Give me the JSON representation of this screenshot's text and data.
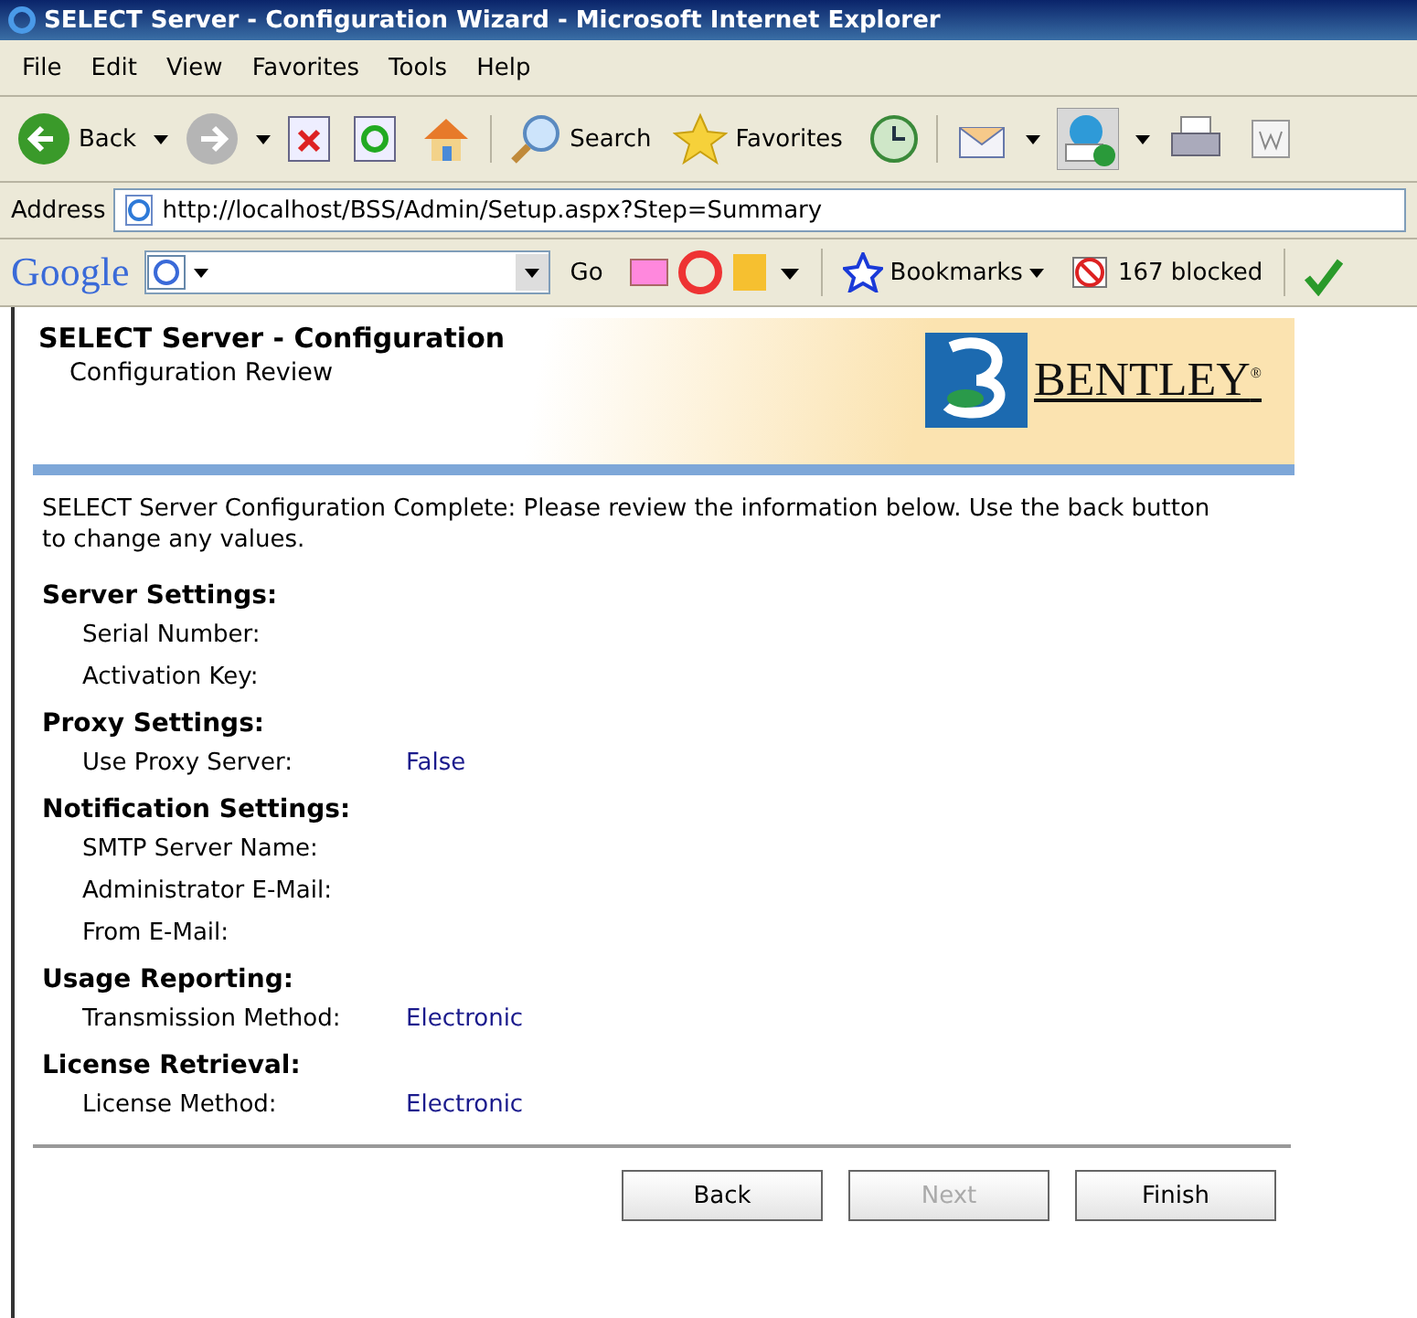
{
  "window": {
    "title": "SELECT Server - Configuration Wizard - Microsoft Internet Explorer"
  },
  "menu": [
    "File",
    "Edit",
    "View",
    "Favorites",
    "Tools",
    "Help"
  ],
  "toolbar": [
    {
      "kind": "back",
      "label": "Back"
    },
    {
      "kind": "forward"
    },
    {
      "kind": "stop"
    },
    {
      "kind": "refresh"
    },
    {
      "kind": "home"
    },
    {
      "kind": "search",
      "label": "Search"
    },
    {
      "kind": "favorites",
      "label": "Favorites"
    },
    {
      "kind": "history"
    },
    {
      "kind": "mail"
    },
    {
      "kind": "phone"
    },
    {
      "kind": "print"
    },
    {
      "kind": "word"
    }
  ],
  "address": {
    "label": "Address",
    "url": "http://localhost/BSS/Admin/Setup.aspx?Step=Summary"
  },
  "google_bar": {
    "brand": "Google",
    "go": "Go",
    "bookmarks": "Bookmarks",
    "blocked": "167 blocked"
  },
  "page": {
    "title": "SELECT Server - Configuration",
    "subtitle": "Configuration Review",
    "logo": {
      "name": "BENTLEY",
      "mark": "®"
    },
    "intro": "SELECT Server Configuration Complete: Please review the information below. Use the back button to change any values.",
    "sections": [
      {
        "heading": "Server Settings:",
        "rows": [
          {
            "label": "Serial Number:"
          },
          {
            "label": "Activation Key:"
          }
        ]
      },
      {
        "heading": "Proxy Settings:",
        "rows": [
          {
            "label": "Use Proxy Server:",
            "value": "False"
          }
        ]
      },
      {
        "heading": "Notification Settings:",
        "rows": [
          {
            "label": "SMTP Server Name:"
          },
          {
            "label": "Administrator E-Mail:"
          },
          {
            "label": "From E-Mail:"
          }
        ]
      },
      {
        "heading": "Usage Reporting:",
        "rows": [
          {
            "label": "Transmission Method:",
            "value": "Electronic"
          }
        ]
      },
      {
        "heading": "License Retrieval:",
        "rows": [
          {
            "label": "License Method:",
            "value": "Electronic"
          }
        ]
      }
    ],
    "buttons": [
      {
        "label": "Back",
        "disabled": false
      },
      {
        "label": "Next",
        "disabled": true
      },
      {
        "label": "Finish",
        "disabled": false
      }
    ]
  }
}
